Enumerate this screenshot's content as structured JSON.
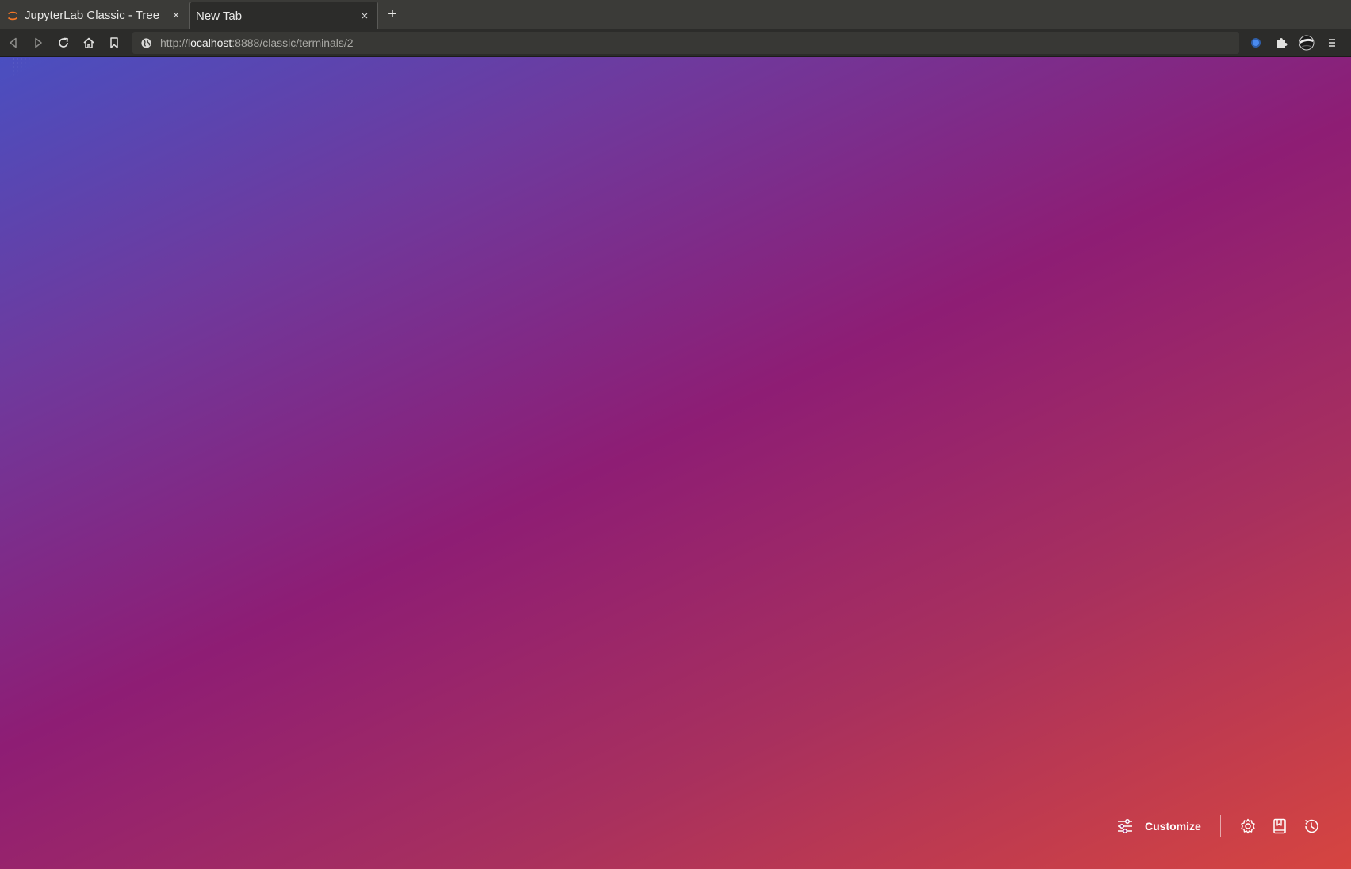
{
  "browser": {
    "tabs": [
      {
        "title": "JupyterLab Classic - Tree",
        "favicon": "jupyter-icon",
        "active": false
      },
      {
        "title": "New Tab",
        "favicon": "none",
        "active": true
      }
    ],
    "close_glyph": "×",
    "new_tab_glyph": "+",
    "url": {
      "scheme": "http://",
      "host": "localhost",
      "rest": ":8888/classic/terminals/2"
    }
  },
  "new_tab_page": {
    "background_gradient": [
      "#4a4fc0",
      "#6e3a9e",
      "#8e1d74",
      "#a8305e",
      "#d64540"
    ],
    "toolbar": {
      "customize_label": "Customize",
      "icons": [
        "sliders-icon",
        "gear-icon",
        "bookmark-book-icon",
        "history-icon"
      ]
    }
  }
}
